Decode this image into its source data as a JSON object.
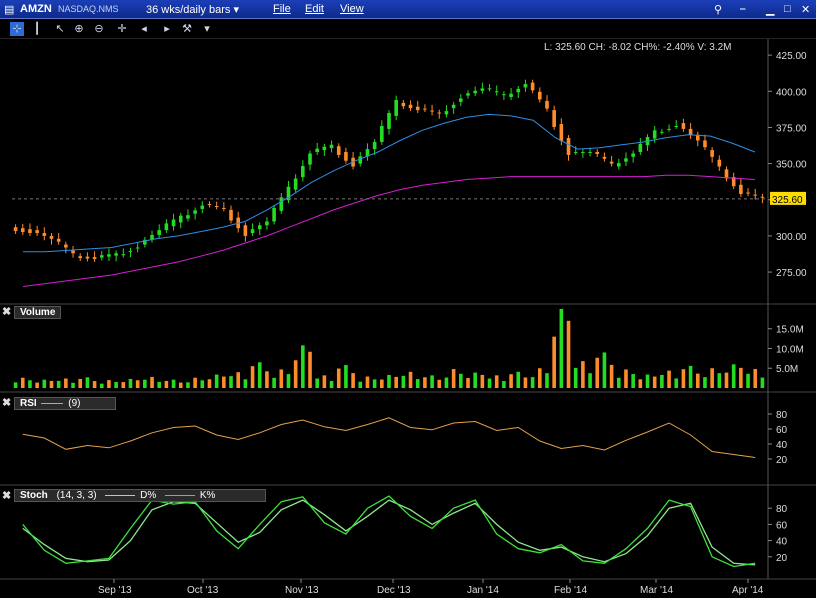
{
  "title_bar": {
    "symbol": "AMZN",
    "exchange": "NASDAQ.NMS",
    "period": "36 wks/daily bars",
    "menus": [
      "File",
      "Edit",
      "View"
    ]
  },
  "info_line": "L: 325.60  CH: -8.02  CH%: -2.40%  V: 3.2M",
  "last_price_label": "325.60",
  "panels": {
    "volume": {
      "label": "Volume",
      "ticks": [
        "15.0M",
        "10.0M",
        "5.0M"
      ]
    },
    "rsi": {
      "label": "RSI",
      "param": "(9)",
      "ticks": [
        "80",
        "60",
        "40",
        "20"
      ]
    },
    "stoch": {
      "label": "Stoch",
      "param": "(14, 3, 3)",
      "d_label": "D%",
      "k_label": "K%",
      "ticks": [
        "80",
        "60",
        "40",
        "20"
      ]
    }
  },
  "x_axis_labels": [
    "Sep '13",
    "Oct '13",
    "Nov '13",
    "Dec '13",
    "Jan '14",
    "Feb '14",
    "Mar '14",
    "Apr '14"
  ],
  "colors": {
    "up": "#22dd22",
    "down": "#ff8c2a",
    "ma_fast": "#2b8fe6",
    "ma_slow": "#d31fd3",
    "rsi": "#e3a24a",
    "stoch_k": "#3ce03c",
    "stoch_d": "#8fe88f",
    "last_price_bg": "#ffdd00"
  },
  "chart_data": {
    "type": "candlestick",
    "price_axis": {
      "ticks": [
        425,
        400,
        375,
        350,
        325,
        300,
        275
      ],
      "range": [
        255,
        432
      ]
    },
    "x_months": [
      "Sep '13",
      "Oct '13",
      "Nov '13",
      "Dec '13",
      "Jan '14",
      "Feb '14",
      "Mar '14",
      "Apr '14"
    ],
    "closes_weekly": [
      304,
      298,
      286,
      285,
      287,
      294,
      304,
      312,
      322,
      318,
      302,
      310,
      332,
      358,
      362,
      350,
      365,
      392,
      388,
      384,
      397,
      402,
      396,
      406,
      387,
      358,
      358,
      348,
      358,
      372,
      378,
      366,
      346,
      330,
      325.6
    ],
    "ma_fast_weekly": [
      289,
      289,
      290,
      291,
      292,
      295,
      298,
      300,
      303,
      306,
      310,
      318,
      327,
      337,
      345,
      352,
      358,
      366,
      373,
      378,
      382,
      384,
      383,
      380,
      368,
      360,
      361,
      363,
      365,
      368,
      370,
      369,
      364,
      358
    ],
    "ma_slow_weekly": [
      265,
      267,
      269,
      271,
      273,
      276,
      279,
      282,
      286,
      290,
      295,
      300,
      306,
      312,
      318,
      323,
      328,
      332,
      335,
      337,
      339,
      340,
      341,
      341,
      341,
      341,
      341,
      341,
      341,
      342,
      342,
      341,
      340,
      339
    ],
    "last": 325.6,
    "volume_weekly_m": [
      2.6,
      2.1,
      2.4,
      2.7,
      2.0,
      2.3,
      2.8,
      2.1,
      2.6,
      3.4,
      4.0,
      6.5,
      4.7,
      10.8,
      3.2,
      5.8,
      2.9,
      3.3,
      4.1,
      3.2,
      4.8,
      3.9,
      3.2,
      4.1,
      5.0,
      20.0,
      6.8,
      9.0,
      4.7,
      3.4,
      4.4,
      5.6,
      5.0,
      6.0,
      4.8
    ],
    "rsi_weekly": [
      53,
      48,
      33,
      38,
      35,
      44,
      55,
      62,
      64,
      52,
      46,
      55,
      66,
      72,
      63,
      58,
      66,
      75,
      62,
      59,
      68,
      70,
      58,
      62,
      44,
      34,
      38,
      32,
      45,
      56,
      68,
      52,
      30,
      26,
      22
    ],
    "stoch_k_weekly": [
      60,
      28,
      12,
      15,
      18,
      55,
      90,
      85,
      88,
      52,
      30,
      60,
      88,
      94,
      62,
      48,
      80,
      95,
      70,
      55,
      80,
      90,
      48,
      30,
      25,
      35,
      15,
      12,
      30,
      55,
      90,
      82,
      20,
      8,
      12
    ],
    "stoch_d_weekly": [
      55,
      35,
      18,
      14,
      16,
      40,
      78,
      88,
      86,
      62,
      38,
      50,
      78,
      90,
      72,
      52,
      70,
      90,
      78,
      60,
      74,
      86,
      60,
      38,
      28,
      32,
      20,
      14,
      24,
      46,
      80,
      86,
      32,
      12,
      10
    ]
  }
}
